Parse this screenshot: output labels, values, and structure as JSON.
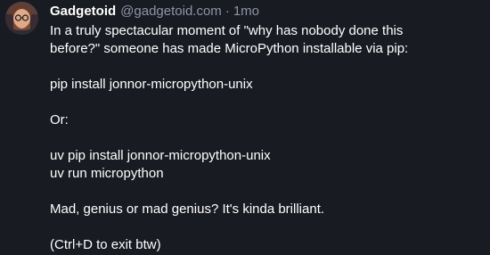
{
  "post": {
    "author": {
      "display_name": "Gadgetoid",
      "handle": "@gadgetoid.com",
      "avatar_icon": "user-avatar"
    },
    "separator": "·",
    "timestamp": "1mo",
    "paragraphs": [
      "In a truly spectacular moment of \"why has nobody done this\nbefore?\" someone has made MicroPython installable via pip:",
      "pip install jonnor-micropython-unix",
      "Or:",
      "uv pip install jonnor-micropython-unix\nuv run micropython",
      "Mad, genius or mad genius? It's kinda brilliant.",
      "(Ctrl+D to exit btw)"
    ]
  },
  "colors": {
    "background": "#191b22",
    "text": "#ffffff",
    "muted": "#8e95a6"
  }
}
